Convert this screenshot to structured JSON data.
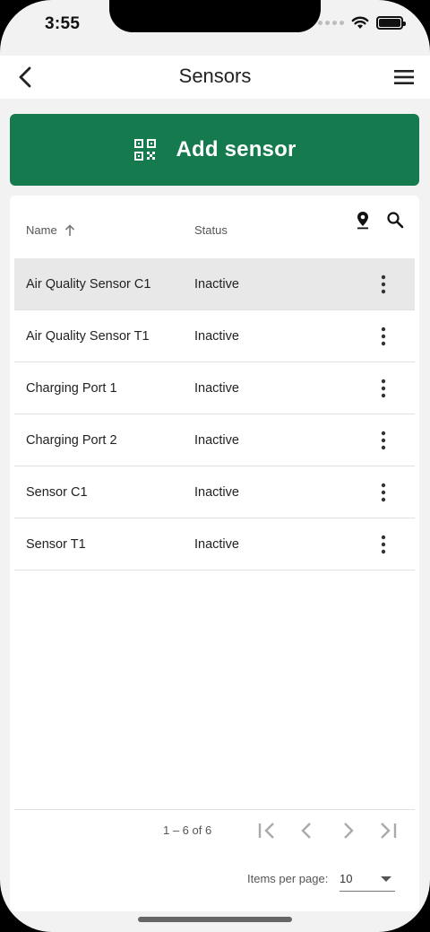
{
  "status_bar": {
    "time": "3:55"
  },
  "appbar": {
    "title": "Sensors"
  },
  "add_button": {
    "label": "Add sensor"
  },
  "table": {
    "columns": {
      "name": "Name",
      "status": "Status"
    },
    "rows": [
      {
        "name": "Air Quality Sensor C1",
        "status": "Inactive"
      },
      {
        "name": "Air Quality Sensor T1",
        "status": "Inactive"
      },
      {
        "name": "Charging Port 1",
        "status": "Inactive"
      },
      {
        "name": "Charging Port 2",
        "status": "Inactive"
      },
      {
        "name": "Sensor C1",
        "status": "Inactive"
      },
      {
        "name": "Sensor T1",
        "status": "Inactive"
      }
    ]
  },
  "paginator": {
    "range_label": "1 – 6 of 6",
    "items_per_page_label": "Items per page:",
    "items_per_page_value": "10"
  },
  "colors": {
    "accent": "#157a4d",
    "selected_row": "#e8e8e8"
  }
}
